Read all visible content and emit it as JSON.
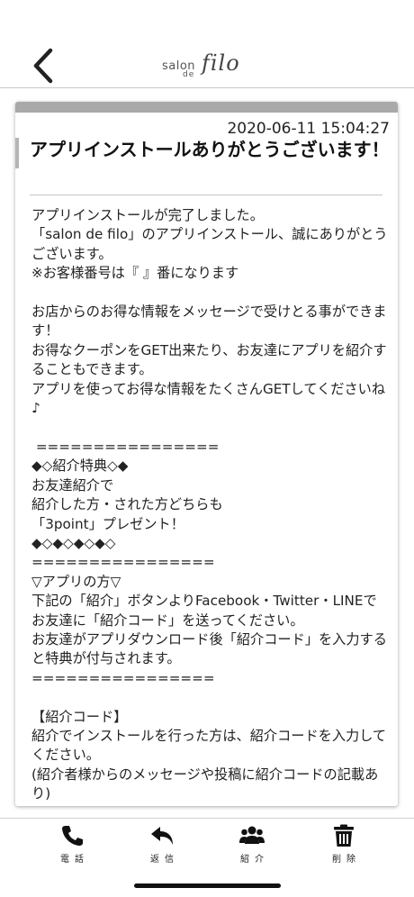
{
  "header": {
    "logo_word1": "salon",
    "logo_word2": "de",
    "logo_word3": "filo"
  },
  "message": {
    "datetime": "2020-06-11 15:04:27",
    "title": "アプリインストールありがとうございます！",
    "body": "アプリインストールが完了しました。\n「salon de filo」のアプリインストール、誠にありがとうございます。\n※お客様番号は『 』番になります\n\nお店からのお得な情報をメッセージで受けとる事ができます！\nお得なクーポンをGET出来たり、お友達にアプリを紹介することもできます。\nアプリを使ってお得な情報をたくさんGETしてくださいね♪\n\n ================\n◆◇紹介特典◇◆\nお友達紹介で\n紹介した方・された方どちらも\n「3point」プレゼント！\n◆◇◆◇◆◇◆◇\n================\n▽アプリの方▽\n下記の「紹介」ボタンよりFacebook・Twitter・LINEでお友達に「紹介コード」を送ってください。\nお友達がアプリダウンロード後「紹介コード」を入力すると特典が付与されます。\n================\n\n【紹介コード】\n紹介でインストールを行った方は、紹介コードを入力してください。\n(紹介者様からのメッセージや投稿に紹介コードの記載あり)"
  },
  "footer": {
    "tabs": [
      {
        "label": "電話",
        "icon": "phone-icon"
      },
      {
        "label": "返信",
        "icon": "reply-icon"
      },
      {
        "label": "紹介",
        "icon": "users-icon"
      },
      {
        "label": "削除",
        "icon": "trash-icon"
      }
    ]
  },
  "colors": {
    "card_topbar": "#a9a9a9",
    "divider": "#c4c4c4",
    "text": "#222222"
  }
}
